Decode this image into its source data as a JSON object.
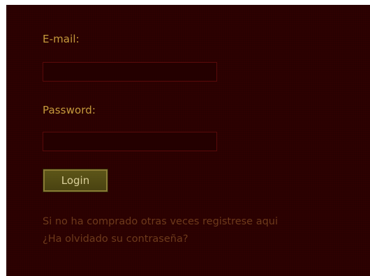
{
  "form": {
    "email_label": "E-mail:",
    "email_value": "",
    "password_label": "Password:",
    "password_value": "",
    "login_button_label": "Login",
    "register_link": "Si no ha comprado otras veces registrese aqui",
    "forgot_password_link": "¿Ha olvidado su contraseña?"
  },
  "colors": {
    "panel_background": "#2e0101",
    "label_text": "#c59a3c",
    "field_background": "#240000",
    "field_border": "#5a0a0a",
    "button_background": "#5c5518",
    "link_text": "#6e3a1b"
  }
}
